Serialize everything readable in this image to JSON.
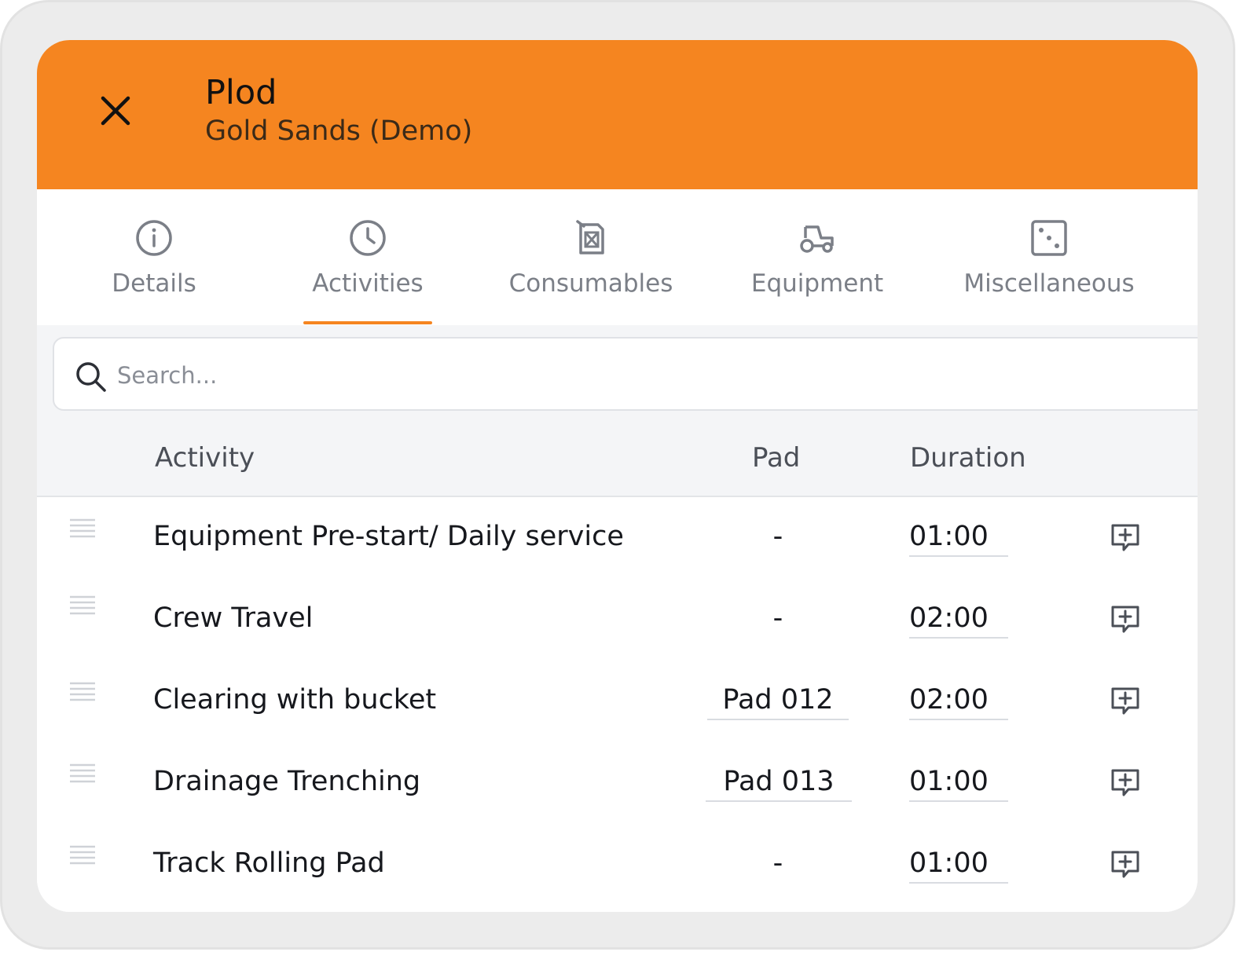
{
  "header": {
    "title": "Plod",
    "subtitle": "Gold Sands (Demo)"
  },
  "tabs": [
    {
      "label": "Details",
      "icon": "info-icon"
    },
    {
      "label": "Activities",
      "icon": "clock-icon",
      "active": true
    },
    {
      "label": "Consumables",
      "icon": "fuel-can-icon"
    },
    {
      "label": "Equipment",
      "icon": "tractor-icon"
    },
    {
      "label": "Miscellaneous",
      "icon": "dice-icon"
    }
  ],
  "search": {
    "placeholder": "Search...",
    "value": ""
  },
  "table": {
    "columns": {
      "activity": "Activity",
      "pad": "Pad",
      "duration": "Duration"
    },
    "rows": [
      {
        "activity": "Equipment Pre-start/ Daily service",
        "pad": "-",
        "duration": "01:00"
      },
      {
        "activity": "Crew Travel",
        "pad": "-",
        "duration": "02:00"
      },
      {
        "activity": "Clearing with bucket",
        "pad": "Pad 012",
        "duration": "02:00"
      },
      {
        "activity": "Drainage Trenching",
        "pad": "Pad 013",
        "duration": "01:00"
      },
      {
        "activity": "Track Rolling Pad",
        "pad": "-",
        "duration": "01:00"
      }
    ]
  },
  "colors": {
    "accent": "#f58520",
    "text": "#16181d",
    "muted": "#7b7f87"
  }
}
